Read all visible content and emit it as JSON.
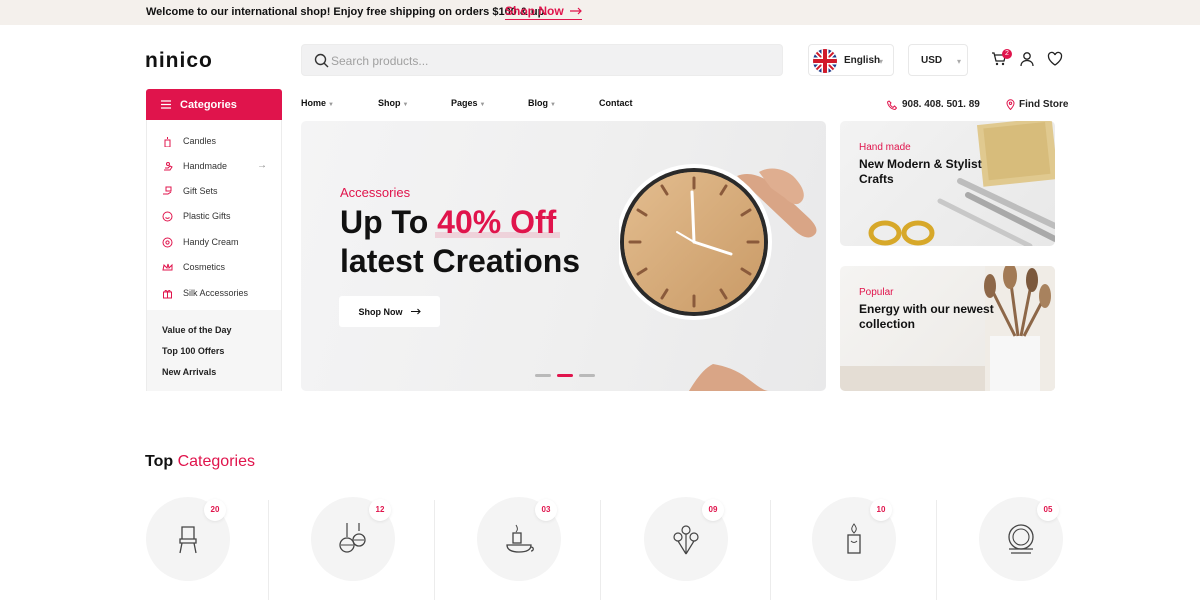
{
  "topbar": {
    "message": "Welcome to our international shop! Enjoy free shipping on orders $100 & up.",
    "shop_link": "Shop Now"
  },
  "brand": {
    "logo": "ninico"
  },
  "search": {
    "placeholder": "Search products..."
  },
  "header": {
    "language": "English",
    "currency": "USD",
    "cart_count": "2",
    "icons": [
      "cart-icon",
      "user-icon",
      "heart-icon"
    ]
  },
  "categories": {
    "heading": "Categories",
    "items": [
      {
        "label": "Candles",
        "icon": "candle-icon"
      },
      {
        "label": "Handmade",
        "icon": "hand-icon",
        "arrow": "→"
      },
      {
        "label": "Gift Sets",
        "icon": "gift-hand-icon"
      },
      {
        "label": "Plastic Gifts",
        "icon": "smile-icon"
      },
      {
        "label": "Handy Cream",
        "icon": "cream-icon"
      },
      {
        "label": "Cosmetics",
        "icon": "crown-icon"
      },
      {
        "label": "Silk Accessories",
        "icon": "gift-box-icon"
      }
    ],
    "bottom_links": [
      "Value of the Day",
      "Top 100 Offers",
      "New Arrivals"
    ]
  },
  "nav": {
    "items": [
      {
        "label": "Home",
        "dropdown": true
      },
      {
        "label": "Shop",
        "dropdown": true
      },
      {
        "label": "Pages",
        "dropdown": true
      },
      {
        "label": "Blog",
        "dropdown": true
      },
      {
        "label": "Contact",
        "dropdown": false
      }
    ],
    "phone": "908. 408. 501. 89",
    "find_store": "Find Store"
  },
  "hero": {
    "subtitle": "Accessories",
    "line1_prefix": "Up To",
    "line1_highlight": "40% Off",
    "line2": "latest Creations",
    "button": "Shop Now",
    "slides": 3,
    "active_slide": 2
  },
  "banners": [
    {
      "tag": "Hand made",
      "title": "New Modern & Stylist Crafts"
    },
    {
      "tag": "Popular",
      "title": "Energy with our newest collection"
    }
  ],
  "top_categories": {
    "title_main": "Top",
    "title_accent": "Categories",
    "items": [
      {
        "count": "20",
        "icon": "chair-icon"
      },
      {
        "count": "12",
        "icon": "ornaments-icon"
      },
      {
        "count": "03",
        "icon": "candle-holder-icon"
      },
      {
        "count": "09",
        "icon": "flowers-icon"
      },
      {
        "count": "10",
        "icon": "candle-icon"
      },
      {
        "count": "05",
        "icon": "plates-icon"
      }
    ]
  },
  "colors": {
    "accent": "#e0144c",
    "topbar_bg": "#f4f0ec"
  }
}
